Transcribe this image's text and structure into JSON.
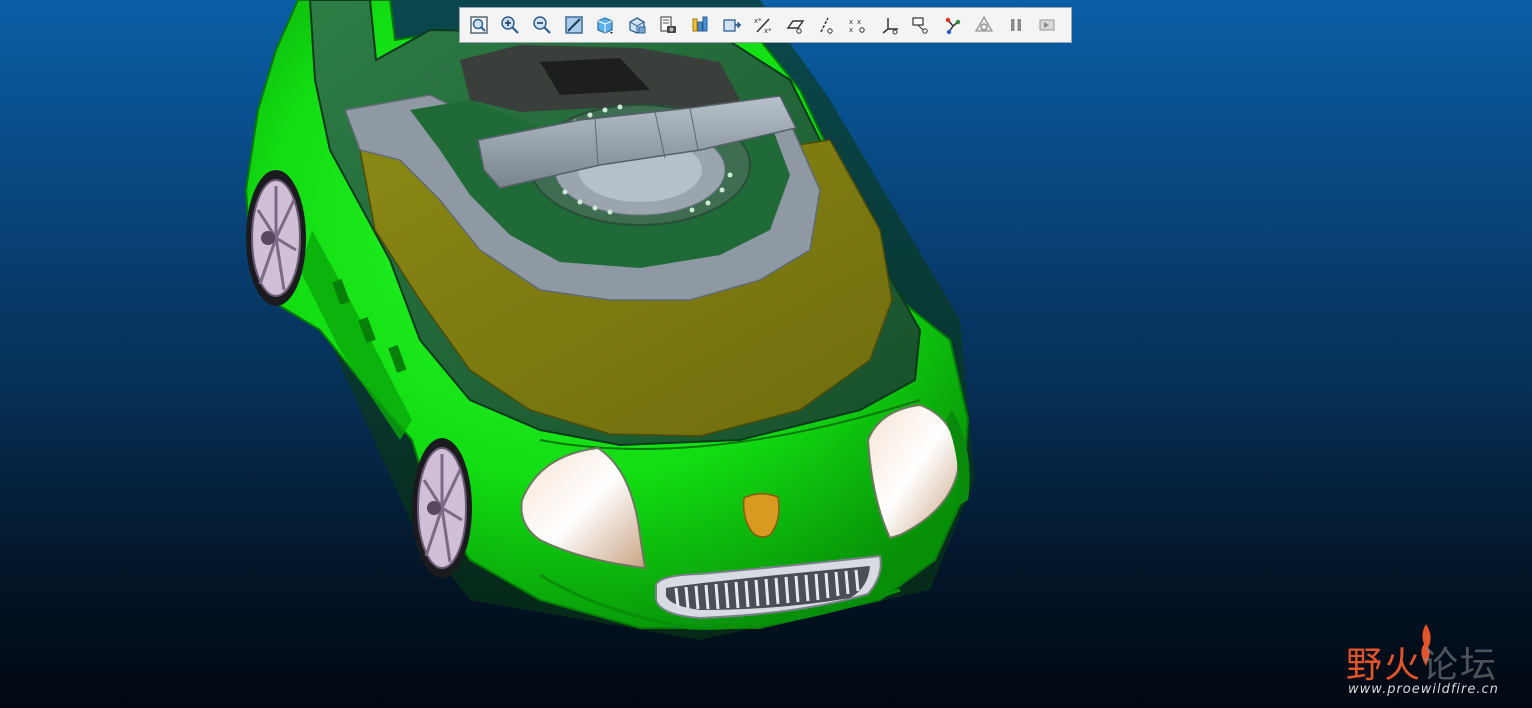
{
  "toolbar": {
    "buttons": [
      {
        "icon": "refit-view-icon"
      },
      {
        "icon": "zoom-in-icon"
      },
      {
        "icon": "zoom-out-icon"
      },
      {
        "icon": "repaint-icon"
      },
      {
        "icon": "display-style-icon"
      },
      {
        "icon": "saved-views-icon"
      },
      {
        "icon": "view-manager-icon"
      },
      {
        "icon": "appearance-gallery-icon"
      },
      {
        "icon": "orient-mode-icon"
      },
      {
        "icon": "datum-display-icon"
      },
      {
        "icon": "datum-planes-icon"
      },
      {
        "icon": "datum-axes-icon"
      },
      {
        "icon": "datum-points-icon"
      },
      {
        "icon": "coordinate-systems-icon"
      },
      {
        "icon": "annotation-display-icon"
      },
      {
        "icon": "spin-center-icon"
      },
      {
        "icon": "regenerate-icon"
      },
      {
        "icon": "pause-icon"
      },
      {
        "icon": "next-icon"
      }
    ]
  },
  "colors": {
    "body_green": "#12e012",
    "shell_dark_green": "#1c6b3a",
    "cover_olive": "#7a7a12",
    "ring_grey": "#8e99a3",
    "headlight": "#e7c4a6",
    "badge": "#d99a22",
    "wheel": "#cfc0d7"
  },
  "watermark": {
    "brand_left": "野火",
    "brand_right": "论坛",
    "url": "www.proewildfire.cn"
  }
}
